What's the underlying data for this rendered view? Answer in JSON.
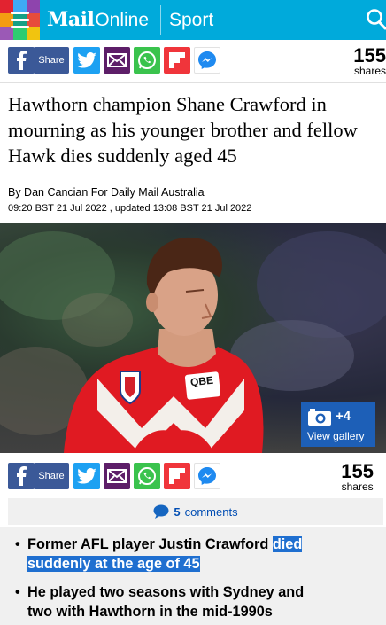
{
  "header": {
    "brand_mail": "Mail",
    "brand_online": "Online",
    "section": "Sport",
    "tile_colors": [
      "#e22330",
      "#3fa9f5",
      "#8e44ad",
      "#f39c12",
      "#16a085",
      "#e74c3c",
      "#9b59b6",
      "#2ecc71",
      "#f1c40f"
    ]
  },
  "share_top": {
    "share_label": "Share",
    "count": "155",
    "count_label": "shares"
  },
  "article": {
    "headline": "Hawthorn champion Shane Crawford in mourning as his younger brother and fellow Hawk dies suddenly aged 45",
    "byline": "By Dan Cancian For Daily Mail Australia",
    "dateline": "09:20 BST 21 Jul 2022 , updated 13:08 BST 21 Jul 2022"
  },
  "photo": {
    "gallery_count": "+4",
    "gallery_label": "View gallery",
    "jersey_text": "QBE"
  },
  "share_bottom": {
    "share_label": "Share",
    "count": "155",
    "count_label": "shares"
  },
  "comments": {
    "count": "5",
    "label": "comments"
  },
  "bullets": [
    {
      "plain": "Former AFL player Justin Crawford ",
      "highlight_1": "died",
      "highlight_2": "suddenly at the age of 45"
    },
    {
      "line_1": "He played two seasons with Sydney and",
      "line_2": "two with Hawthorn in the mid-1990s"
    }
  ]
}
